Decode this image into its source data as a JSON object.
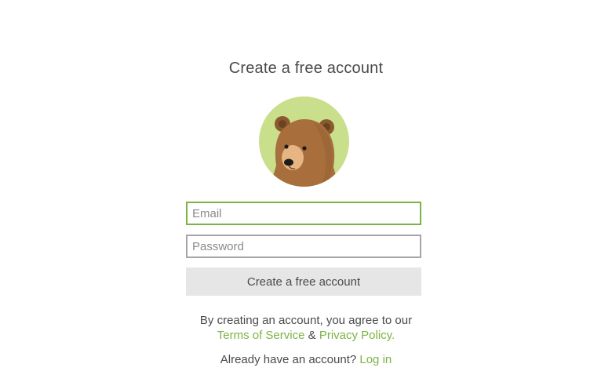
{
  "header": {
    "title": "Create a free account"
  },
  "avatar": {
    "icon": "bear-mascot-icon",
    "background_color": "#c9df8c",
    "fur_color": "#a86e3c"
  },
  "form": {
    "email_placeholder": "Email",
    "password_placeholder": "Password",
    "submit_label": "Create a free account"
  },
  "terms": {
    "intro": "By creating an account, you agree to our",
    "tos_label": "Terms of Service",
    "and": "&",
    "privacy_label": "Privacy Policy."
  },
  "login": {
    "prompt": "Already have an account?",
    "link_label": "Log in"
  },
  "colors": {
    "accent": "#7cb342",
    "text": "#4a4a4a",
    "button_bg": "#e6e6e6"
  }
}
